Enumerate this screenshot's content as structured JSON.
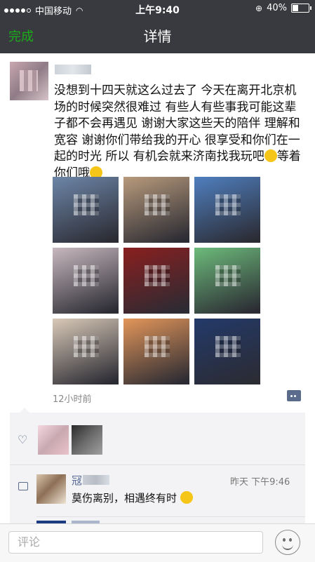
{
  "status_bar": {
    "carrier": "中国移动",
    "time": "上午9:40",
    "battery": "40%",
    "battery_level": 0.4
  },
  "nav": {
    "back_label": "完成",
    "title": "详情"
  },
  "post": {
    "text": "没想到十四天就这么过去了 今天在离开北京机场的时候突然很难过 有些人有些事我可能这辈子都不会再遇见  谢谢大家这些天的陪伴 理解和宽容  谢谢你们带给我的开心  很享受和你们在一起的时光     所以  有机会就来济南找我玩吧",
    "text_tail": "等着你们哦",
    "time_ago": "12小时前",
    "photo_colors": [
      [
        "#6d86a8",
        "#b89a7c",
        "#4f7fbf"
      ],
      [
        "#c8b8bf",
        "#8a1f1f",
        "#6dbb7b"
      ],
      [
        "#d9c9b8",
        "#e3965a",
        "#233a6a"
      ]
    ]
  },
  "likes": {
    "icon": "heart-icon"
  },
  "comments": [
    {
      "name": "冦",
      "time": "昨天 下午9:46",
      "text": "莫伤离别，相遇终有时"
    }
  ],
  "input": {
    "placeholder": "评论"
  },
  "colors": {
    "nav_bg": "#393a3f",
    "accent_green": "#1aad19",
    "link_blue": "#576b95"
  }
}
